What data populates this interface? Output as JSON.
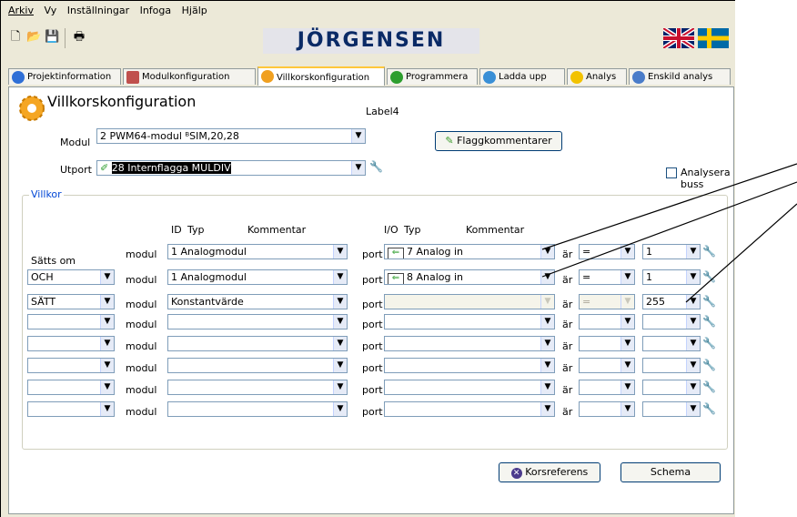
{
  "menu": [
    "Arkiv",
    "Vy",
    "Inställningar",
    "Infoga",
    "Hjälp"
  ],
  "brand": "JÖRGENSEN",
  "tabs": [
    "Projektinformation",
    "Modulkonfiguration",
    "Villkorskonfiguration",
    "Programmera",
    "Ladda upp",
    "Analys",
    "Enskild analys"
  ],
  "page_title": "Villkorskonfiguration",
  "label4": "Label4",
  "modul_label": "Modul",
  "modul_value": "2 PWM64-modul  ᴮSIM,20,28",
  "utport_label": "Utport",
  "utport_value": "28 Internflagga MULDIV",
  "flagg_button": "Flaggkommentarer",
  "analysera_label": "Analysera buss",
  "villkor_label": "Villkor",
  "col_headers": {
    "id": "ID",
    "typ": "Typ",
    "kommentar": "Kommentar",
    "io": "I/O",
    "typ2": "Typ",
    "kommentar2": "Kommentar"
  },
  "satts_om": "Sätts om",
  "word_modul": "modul",
  "word_port": "port",
  "word_ar": "är",
  "rows": [
    {
      "op": "",
      "module": "1 Analogmodul",
      "port": "7 Analog in",
      "cmp": "=",
      "val": "1",
      "port_disabled": false
    },
    {
      "op": "OCH",
      "module": "1 Analogmodul",
      "port": "8 Analog in",
      "cmp": "=",
      "val": "1",
      "port_disabled": false
    },
    {
      "op": "SÄTT",
      "module": "Konstantvärde",
      "port": "",
      "cmp": "=",
      "val": "255",
      "port_disabled": true
    },
    {
      "op": "",
      "module": "",
      "port": "",
      "cmp": "",
      "val": "",
      "port_disabled": false
    },
    {
      "op": "",
      "module": "",
      "port": "",
      "cmp": "",
      "val": "",
      "port_disabled": false
    },
    {
      "op": "",
      "module": "",
      "port": "",
      "cmp": "",
      "val": "",
      "port_disabled": false
    },
    {
      "op": "",
      "module": "",
      "port": "",
      "cmp": "",
      "val": "",
      "port_disabled": false
    },
    {
      "op": "",
      "module": "",
      "port": "",
      "cmp": "",
      "val": "",
      "port_disabled": false
    }
  ],
  "korsreferens_button": "Korsreferens",
  "schema_button": "Schema",
  "colors": {
    "brand_text": "#0a2a66",
    "tab_active_accent": "#ffc73c",
    "border": "#7f9db9",
    "arrow_green": "#2e9e2e"
  }
}
